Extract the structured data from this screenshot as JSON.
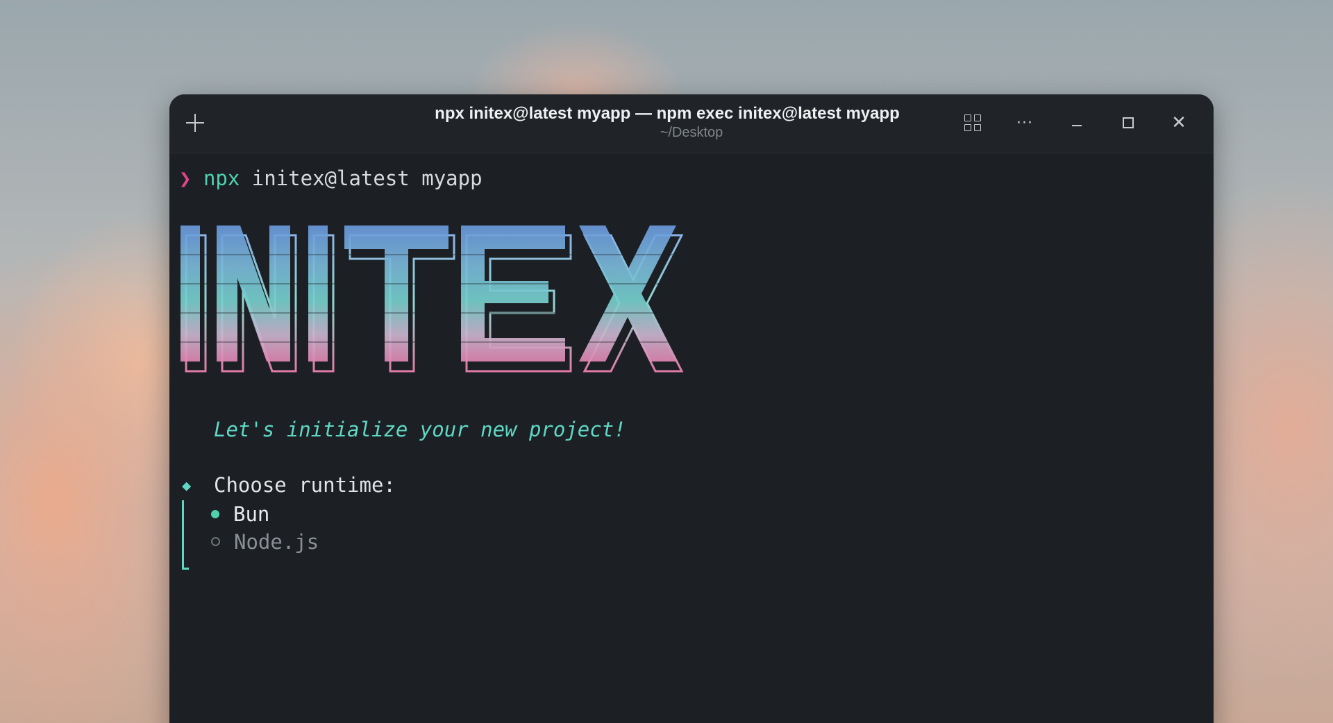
{
  "window": {
    "title": "npx initex@latest myapp — npm exec initex@latest myapp",
    "subtitle": "~/Desktop",
    "icons": {
      "new_tab": "plus-icon",
      "layout": "grid-icon",
      "more": "more-icon",
      "minimize": "minimize-icon",
      "maximize": "maximize-icon",
      "close": "close-icon"
    },
    "more_glyph": "···",
    "close_glyph": "✕"
  },
  "terminal": {
    "prompt_symbol": "❯",
    "command_program": "npx",
    "command_args": "initex@latest myapp",
    "banner_text": "INITEX",
    "tagline": "Let's initialize your new project!",
    "question_marker": "◆",
    "question": "Choose runtime:",
    "options": [
      {
        "label": "Bun",
        "selected": true
      },
      {
        "label": "Node.js",
        "selected": false
      }
    ]
  },
  "colors": {
    "background": "#1c2024",
    "accent": "#5fd7c4",
    "prompt": "#e0468a",
    "banner_gradient": [
      "#6fa3e0",
      "#74cfd0",
      "#d9a9c9",
      "#e07aa8"
    ]
  }
}
